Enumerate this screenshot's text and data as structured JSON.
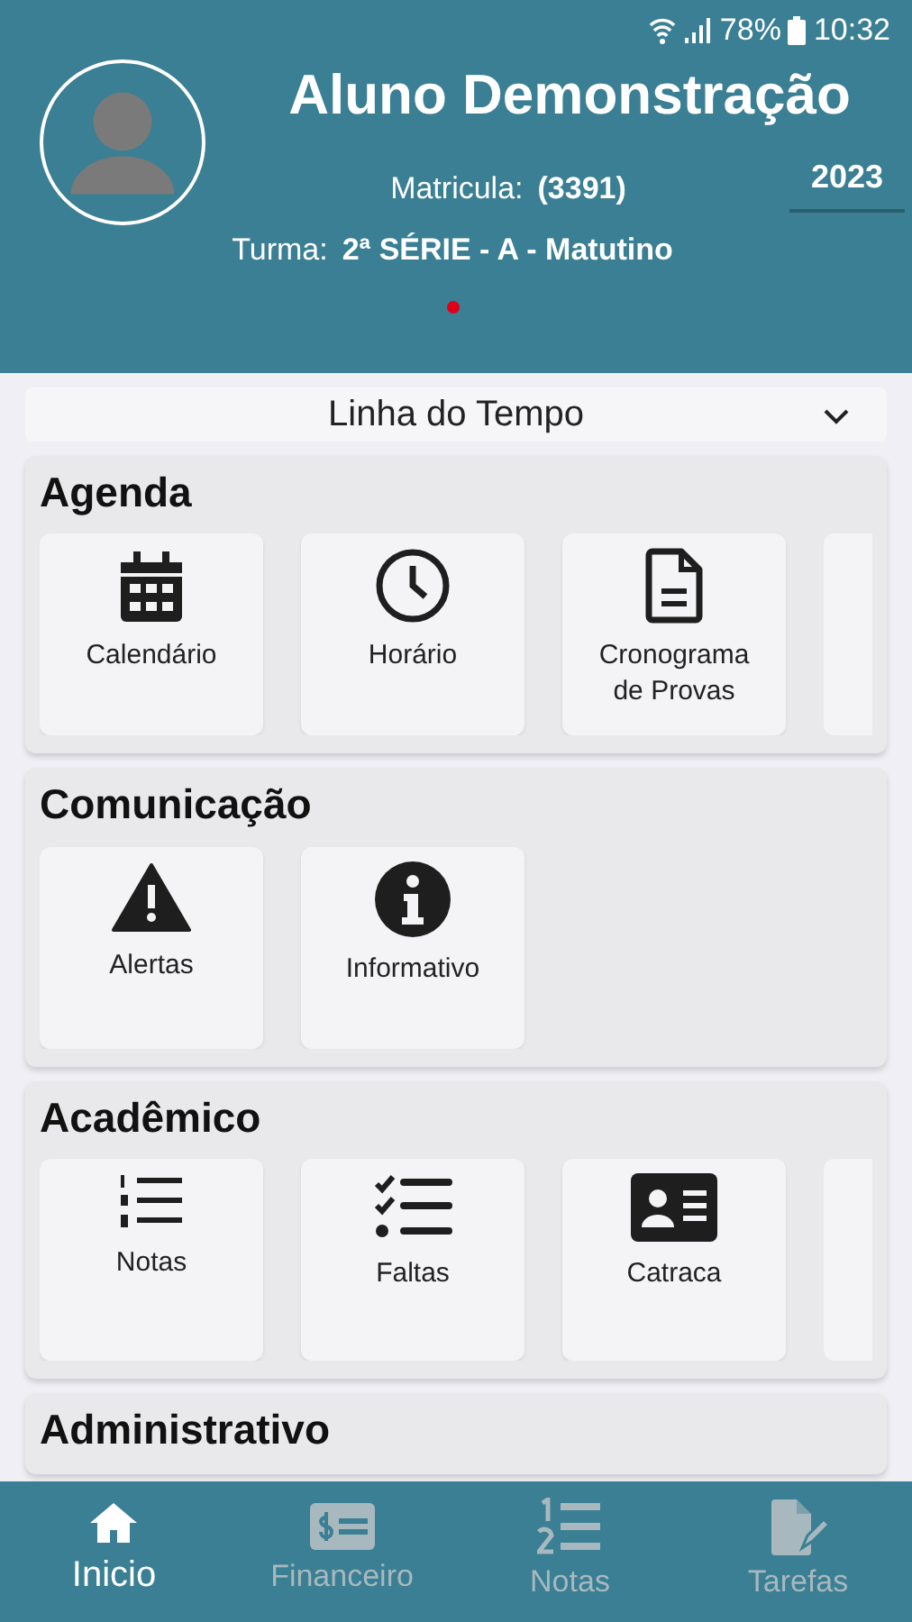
{
  "status_bar": {
    "battery": "78%",
    "time": "10:32"
  },
  "profile": {
    "name": "Aluno Demonstração",
    "matricula_label": "Matricula:",
    "matricula": "(3391)",
    "turma_label": "Turma:",
    "turma": "2ª SÉRIE - A - Matutino",
    "year": "2023"
  },
  "timeline": {
    "label": "Linha do Tempo",
    "expanded": false
  },
  "sections": [
    {
      "title": "Agenda",
      "partial_tile": true,
      "items": [
        {
          "label": "Calendário",
          "kind": "calendar"
        },
        {
          "label": "Horário",
          "kind": "clock"
        },
        {
          "label": "Cronograma de Provas",
          "kind": "document"
        }
      ]
    },
    {
      "title": "Comunicação",
      "items": [
        {
          "label": "Alertas",
          "kind": "warning"
        },
        {
          "label": "Informativo",
          "kind": "info"
        }
      ]
    },
    {
      "title": "Acadêmico",
      "partial_tile": true,
      "items": [
        {
          "label": "Notas",
          "kind": "numbered"
        },
        {
          "label": "Faltas",
          "kind": "checklist"
        },
        {
          "label": "Catraca",
          "kind": "idcard"
        }
      ]
    },
    {
      "title": "Administrativo"
    }
  ],
  "bottom_nav": [
    {
      "label": "Inicio",
      "kind": "home",
      "selected": true
    },
    {
      "label": "Financeiro",
      "kind": "money",
      "selected": false
    },
    {
      "label": "Notas",
      "kind": "numbered2",
      "selected": false
    },
    {
      "label": "Tarefas",
      "kind": "task",
      "selected": false
    }
  ]
}
